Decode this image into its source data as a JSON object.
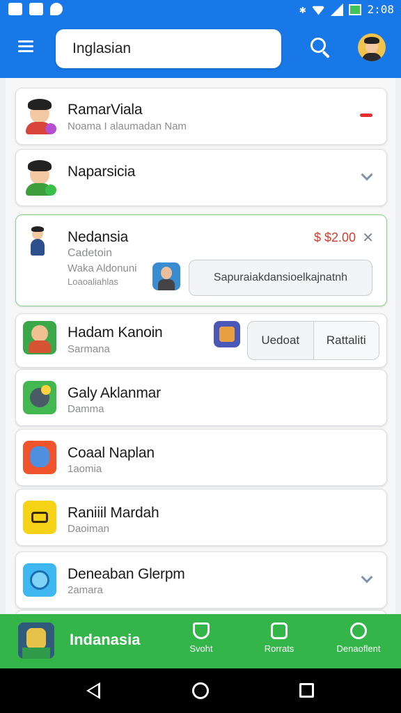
{
  "status_bar": {
    "time": "2:08"
  },
  "app_bar": {
    "search_value": "Inglasian"
  },
  "list": [
    {
      "title": "RamarViala",
      "subtitle": "Noama I alaumadan Nam"
    },
    {
      "title": "Naparsicia"
    },
    {
      "title": "Nedansia",
      "subtitle": "Cadetoin",
      "line2": "Waka Aldonuni",
      "line3": "Loaoaliahlas",
      "price": "$ $2.00",
      "close_glyph": "✕",
      "action_pill": "Sapuraiakdansioelkajnatnh"
    },
    {
      "title": "Hadam Kanoin",
      "subtitle": "Sarmana",
      "action_left": "Uedoat",
      "action_right": "Rattaliti"
    },
    {
      "title": "Galy Aklanmar",
      "subtitle": "Damma"
    },
    {
      "title": "Coaal Naplan",
      "subtitle": "1aomia"
    },
    {
      "title": "Raniiil Mardah",
      "subtitle": "Daoiman"
    },
    {
      "title": "Deneaban Glerpm",
      "subtitle": "2amara"
    }
  ],
  "bottom_bar": {
    "title": "Indanasia",
    "tabs": [
      {
        "label": "Svoht",
        "icon": "shield-icon"
      },
      {
        "label": "Rorrats",
        "icon": "people-icon"
      },
      {
        "label": "Denaoflent",
        "icon": "compass-icon"
      }
    ]
  },
  "colors": {
    "app_bar": "#1878e8",
    "bottom_bar": "#33b54a",
    "price": "#d43b2b",
    "accent_dash": "#e32f2f"
  }
}
